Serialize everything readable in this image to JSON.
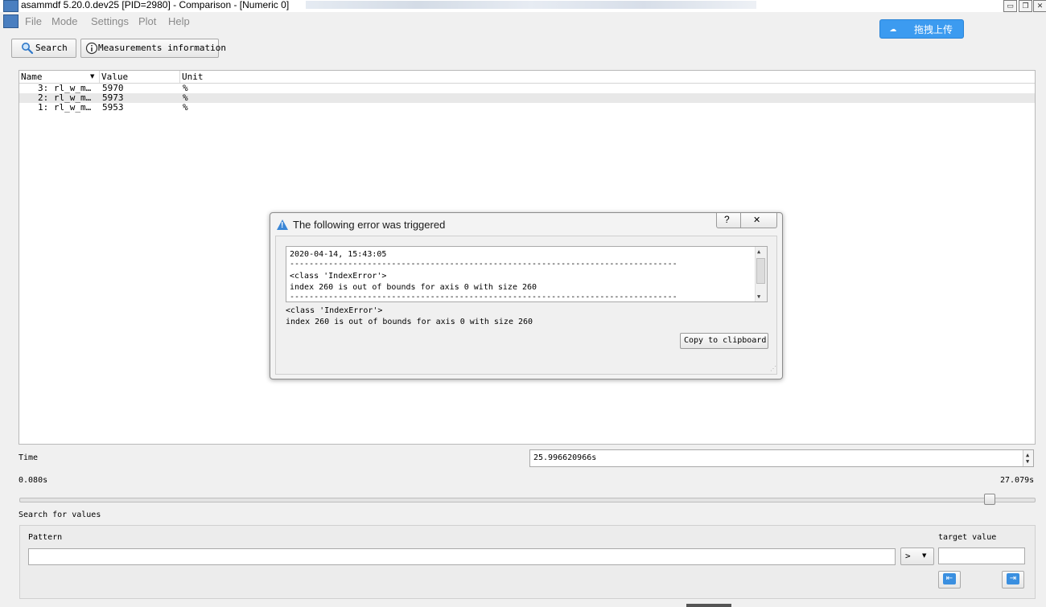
{
  "window": {
    "title": "asammdf 5.20.0.dev25 [PID=2980] - Comparison - [Numeric 0]",
    "min_glyph": "▭",
    "restore_glyph": "❐",
    "close_glyph": "✕"
  },
  "menubar": {
    "items": [
      "File",
      "Mode",
      "Settings",
      "Plot",
      "Help"
    ],
    "cloud_button_label": "拖拽上传"
  },
  "toolbar": {
    "search_label": "Search",
    "measurements_label": "Measurements information"
  },
  "table": {
    "columns": [
      "Name",
      "Value",
      "Unit"
    ],
    "rows": [
      {
        "name": "3: rl_w_m…",
        "value": "5970",
        "unit": "%"
      },
      {
        "name": "2: rl_w_m…",
        "value": "5973",
        "unit": "%"
      },
      {
        "name": "1: rl_w_m…",
        "value": "5953",
        "unit": "%"
      }
    ]
  },
  "dialog": {
    "title": "The following error was triggered",
    "help_glyph": "?",
    "close_glyph": "✕",
    "details": [
      "2020-04-14, 15:43:05",
      "--------------------------------------------------------------------------------",
      "<class 'IndexError'>",
      "index 260 is out of bounds for axis 0 with size 260",
      "--------------------------------------------------------------------------------"
    ],
    "message_line1": "<class 'IndexError'>",
    "message_line2": "index 260 is out of bounds for axis 0 with size 260",
    "copy_button": "Copy to clipboard"
  },
  "time": {
    "label": "Time",
    "value": "25.996620966s",
    "min_label": "0.080s",
    "max_label": "27.079s",
    "slider_fraction": 0.96
  },
  "search_values": {
    "label": "Search for values",
    "pattern_label": "Pattern",
    "pattern_value": "",
    "operator": ">",
    "target_label": "target value",
    "target_value": ""
  }
}
